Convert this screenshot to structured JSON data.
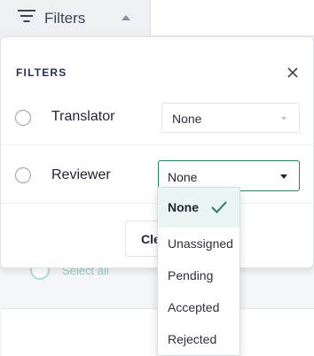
{
  "toolbar": {
    "filters_tab_label": "Filters"
  },
  "panel": {
    "title": "FILTERS",
    "rows": [
      {
        "label": "Translator",
        "selected_value": "None"
      },
      {
        "label": "Reviewer",
        "selected_value": "None"
      }
    ],
    "clear_button_label": "Clear"
  },
  "dropdown": {
    "options": [
      {
        "label": "None",
        "selected": true
      },
      {
        "label": "Unassigned",
        "selected": false
      },
      {
        "label": "Pending",
        "selected": false
      },
      {
        "label": "Accepted",
        "selected": false
      },
      {
        "label": "Rejected",
        "selected": false
      }
    ]
  },
  "background": {
    "select_all_label": "Select all"
  },
  "colors": {
    "accent": "#2e7d6c",
    "selected_option_bg": "#e9f5f2",
    "title_color": "#2a2f5a"
  },
  "icons": {
    "filters_tab": "filter-lines-icon",
    "close": "close-icon",
    "check": "check-icon"
  }
}
